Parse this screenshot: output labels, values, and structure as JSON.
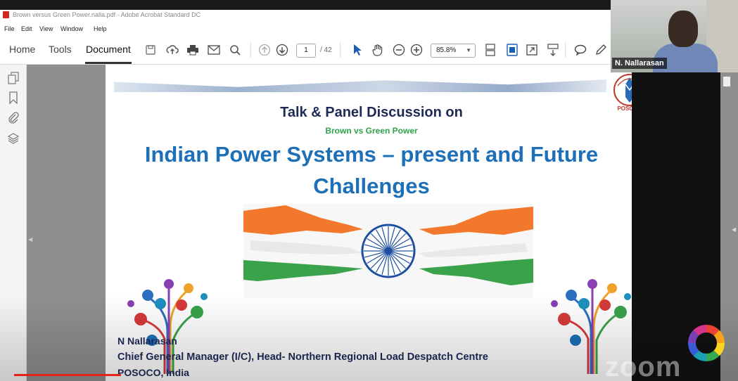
{
  "window": {
    "title": "Brown versus Green Power.nalla.pdf - Adobe Acrobat Standard DC"
  },
  "menu": [
    "File",
    "Edit",
    "View",
    "Window",
    "Help"
  ],
  "tabs": [
    "Home",
    "Tools",
    "Document"
  ],
  "toolbar": {
    "current_page": "1",
    "total_pages": "/ 42",
    "zoom_level": "85.8%"
  },
  "slide": {
    "heading": "Talk & Panel Discussion on",
    "subheading": "Brown vs Green Power",
    "title_line1": "Indian Power Systems – present and Future",
    "title_line2": "Challenges",
    "speaker_name": "N Nallarasan",
    "speaker_role": "Chief General Manager (I/C), Head- Northern Regional Load Despatch Centre",
    "speaker_org": "POSOCO, India",
    "logo_text": "POSOCO"
  },
  "webcam": {
    "participant_name": "N. Nallarasan"
  },
  "watermark": "zoom",
  "colors": {
    "heading": "#1d2a56",
    "subheading": "#2fa34b",
    "title": "#1d6fb8",
    "progress": "#e62117"
  },
  "icons": {
    "toolbar": [
      "save-icon",
      "upload-icon",
      "print-icon",
      "email-icon",
      "search-icon",
      "page-up-icon",
      "page-down-icon",
      "select-pointer-icon",
      "hand-icon",
      "zoom-out-icon",
      "zoom-in-icon",
      "fit-page-icon",
      "scan-icon",
      "fullscreen-icon",
      "scroll-mode-icon",
      "comment-icon",
      "pen-icon"
    ],
    "sidebar": [
      "page-thumbnails-icon",
      "bookmark-icon",
      "attachment-icon",
      "layers-icon"
    ]
  }
}
